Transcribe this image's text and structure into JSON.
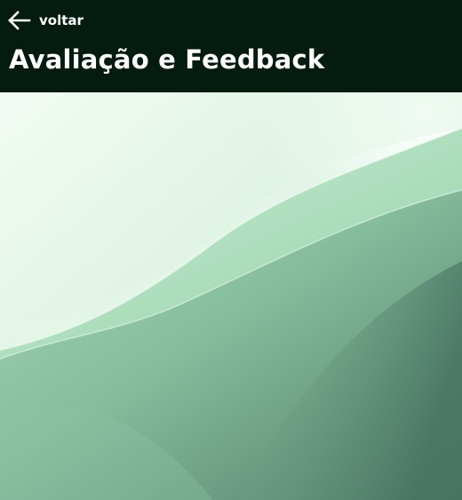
{
  "header": {
    "back_label": "voltar",
    "back_icon": "arrow-left-icon",
    "title": "Avaliação e Feedback"
  },
  "colors": {
    "header_bg": "#041b0f",
    "header_text": "#ffffff",
    "hero_light": "#eaf8ee",
    "hero_mid": "#a6dcb7",
    "hero_dark": "#5a8a78"
  }
}
